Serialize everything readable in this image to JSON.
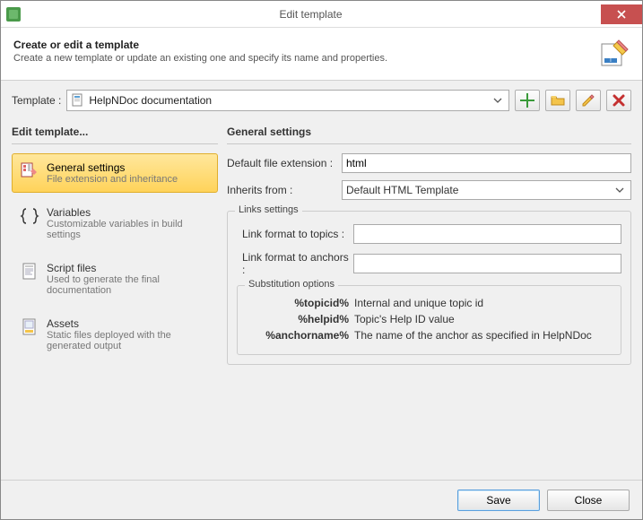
{
  "titlebar": {
    "title": "Edit template"
  },
  "header": {
    "title": "Create or edit a template",
    "subtitle": "Create a new template or update an existing one and specify its name and properties."
  },
  "templateRow": {
    "label": "Template :",
    "selected": "HelpNDoc documentation"
  },
  "leftPanel": {
    "header": "Edit template...",
    "items": [
      {
        "title": "General settings",
        "sub": "File extension and inheritance"
      },
      {
        "title": "Variables",
        "sub": "Customizable variables in build settings"
      },
      {
        "title": "Script files",
        "sub": "Used to generate the final documentation"
      },
      {
        "title": "Assets",
        "sub": "Static files deployed with the generated output"
      }
    ]
  },
  "rightPanel": {
    "header": "General settings",
    "defaultExtLabel": "Default file extension :",
    "defaultExtValue": "html",
    "inheritsLabel": "Inherits from :",
    "inheritsValue": "Default HTML Template",
    "linksLegend": "Links settings",
    "linkTopicsLabel": "Link format to topics :",
    "linkAnchorsLabel": "Link format to anchors :",
    "substLegend": "Substitution options",
    "subst": [
      {
        "key": "%topicid%",
        "val": "Internal and unique topic id"
      },
      {
        "key": "%helpid%",
        "val": "Topic's Help ID value"
      },
      {
        "key": "%anchorname%",
        "val": "The name of the anchor as specified in HelpNDoc"
      }
    ]
  },
  "footer": {
    "save": "Save",
    "close": "Close"
  }
}
